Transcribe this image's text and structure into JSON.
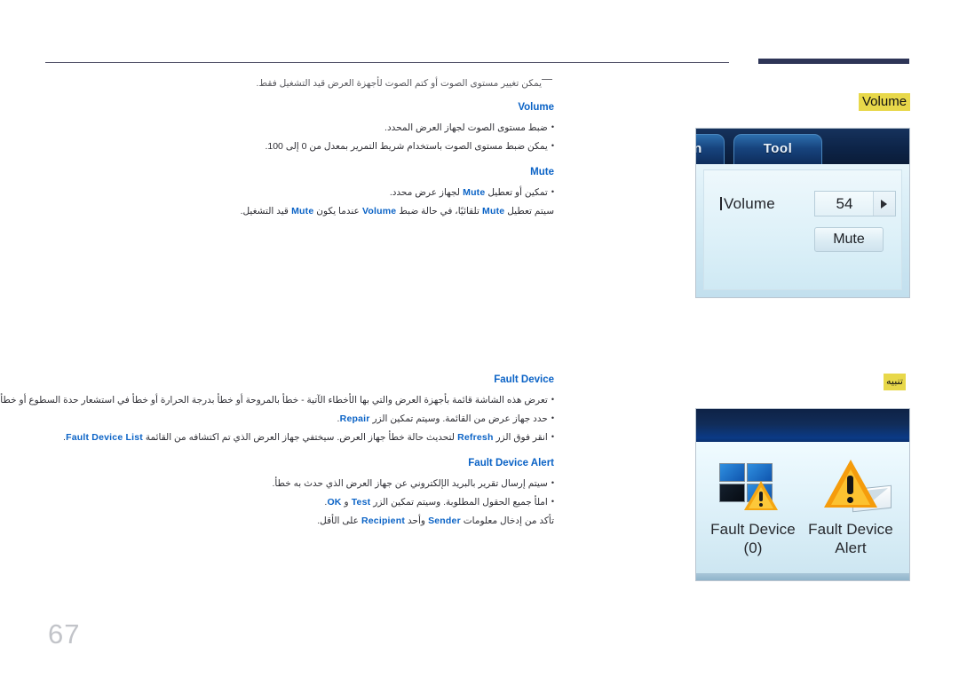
{
  "page": {
    "number": "67"
  },
  "header": {
    "rule_color": "#4b4b63",
    "accent_bar_color": "#2e3557"
  },
  "note": {
    "text": "يمكن تغيير مستوى الصوت أو كتم الصوت لأجهزة العرض قيد التشغيل فقط."
  },
  "sections": [
    {
      "id": "volume",
      "heading": "Volume",
      "bullets": [
        "ضبط مستوى الصوت لجهاز العرض المحدد.",
        "يمكن ضبط مستوى الصوت باستخدام شريط التمرير بمعدل من 0 إلى 100."
      ]
    },
    {
      "id": "mute",
      "heading": "Mute",
      "bullets": [
        "تمكين أو تعطيل Mute لجهاز عرض محدد.",
        "سيتم تعطيل Mute تلقائيًا، في حالة ضبط Volume عندما يكون Mute قيد التشغيل."
      ]
    },
    {
      "id": "fault-device",
      "heading": "Fault Device",
      "bullets": [
        "تعرض هذه الشاشة قائمة بأجهزة العرض والتي بها الأخطاء الآتية - خطأ بالمروحة أو خطأ بدرجة الحرارة أو خطأ في استشعار حدة السطوع أو خطأ في المصباح.",
        "حدد جهاز عرض من القائمة. وسيتم تمكين الزر Repair.",
        "انقر فوق الزر Refresh لتحديث حالة خطأ جهاز العرض. سيختفي جهاز العرض الذي تم اكتشافه من القائمة Fault Device List."
      ]
    },
    {
      "id": "fault-device-alert",
      "heading": "Fault Device Alert",
      "bullets": [
        "سيتم إرسال تقرير بالبريد الإلكتروني عن جهاز العرض الذي حدث به خطأ.",
        "املأ جميع الحقول المطلوبة. وسيتم تمكين الزر Test و OK.",
        "تأكد من إدخال معلومات Sender وأحد Recipient على الأقل."
      ]
    }
  ],
  "callouts": {
    "volume_label": "Volume",
    "caution_label": "تنبيه"
  },
  "volume_screenshot": {
    "tab_partial": "n",
    "tab_tool": "Tool",
    "field_label": "Volume",
    "field_value": "54",
    "stepper_icon": "caret-right-icon",
    "mute_button": "Mute"
  },
  "fault_screenshot": {
    "items": [
      {
        "icon": "monitor-grid-warning-icon",
        "caption_line1": "Fault Device",
        "caption_line2": "(0)"
      },
      {
        "icon": "warning-envelope-icon",
        "caption_line1": "Fault Device",
        "caption_line2": "Alert"
      }
    ]
  },
  "colors": {
    "heading_blue": "#0b63c6",
    "highlight_yellow": "#e8d84a",
    "page_number_gray": "#c2c4c9"
  }
}
